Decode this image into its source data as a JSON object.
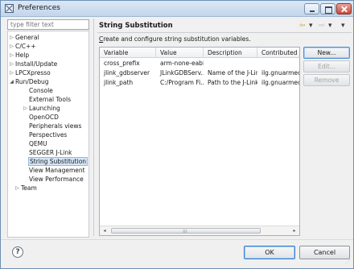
{
  "window": {
    "title": "Preferences",
    "icon": "preferences-x-icon"
  },
  "filter": {
    "placeholder": "type filter text"
  },
  "tree": {
    "items": [
      {
        "label": "General",
        "arrow": "▷"
      },
      {
        "label": "C/C++",
        "arrow": "▷"
      },
      {
        "label": "Help",
        "arrow": "▷"
      },
      {
        "label": "Install/Update",
        "arrow": "▷"
      },
      {
        "label": "LPCXpresso",
        "arrow": "▷"
      },
      {
        "label": "Run/Debug",
        "arrow": "◢"
      },
      {
        "label": "Console",
        "arrow": ""
      },
      {
        "label": "External Tools",
        "arrow": ""
      },
      {
        "label": "Launching",
        "arrow": "▷"
      },
      {
        "label": "OpenOCD",
        "arrow": ""
      },
      {
        "label": "Peripherals views",
        "arrow": ""
      },
      {
        "label": "Perspectives",
        "arrow": ""
      },
      {
        "label": "QEMU",
        "arrow": ""
      },
      {
        "label": "SEGGER J-Link",
        "arrow": ""
      },
      {
        "label": "String Substitution",
        "arrow": "",
        "selected": true
      },
      {
        "label": "View Management",
        "arrow": ""
      },
      {
        "label": "View Performance",
        "arrow": ""
      },
      {
        "label": "Team",
        "arrow": "▷"
      }
    ]
  },
  "page": {
    "title": "String Substitution",
    "description_prefix": "",
    "description_mnemonic": "C",
    "description_rest": "reate and configure string substitution variables.",
    "nav": {
      "back": "⇦",
      "back_menu": "▾",
      "forward": "⇨",
      "forward_menu": "▾",
      "view_menu": "▾"
    }
  },
  "table": {
    "columns": [
      "Variable",
      "Value",
      "Description",
      "Contributed By"
    ],
    "rows": [
      [
        "cross_prefix",
        "arm-none-eabi-",
        "",
        ""
      ],
      [
        "jlink_gdbserver",
        "JLinkGDBServ...",
        "Name of the J-Lin...",
        "ilg.gnuarmeclip"
      ],
      [
        "jlink_path",
        "C:/Program Fi...",
        "Path to the J-Link ...",
        "ilg.gnuarmeclip"
      ]
    ],
    "scroll_left": "◂",
    "scroll_right": "▸",
    "scroll_grip": "⁞⁞⁞"
  },
  "side_buttons": {
    "new": "New...",
    "edit": "Edit...",
    "remove": "Remove"
  },
  "footer": {
    "help_glyph": "?",
    "ok": "OK",
    "cancel": "Cancel"
  }
}
